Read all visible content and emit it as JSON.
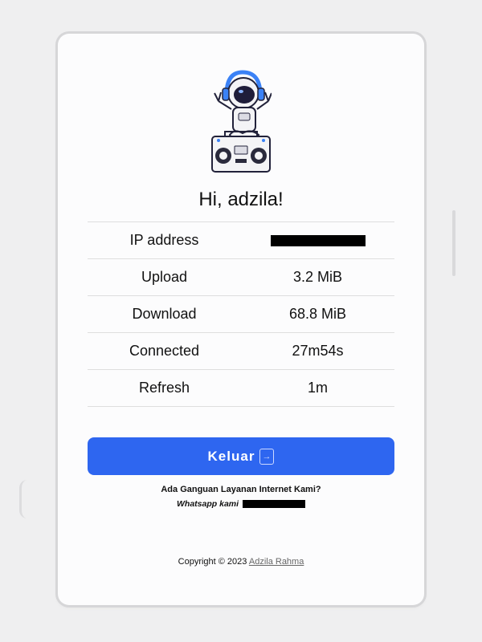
{
  "greeting": "Hi, adzila!",
  "info_rows": [
    {
      "label": "IP address",
      "value": "",
      "redacted": true
    },
    {
      "label": "Upload",
      "value": "3.2 MiB"
    },
    {
      "label": "Download",
      "value": "68.8 MiB"
    },
    {
      "label": "Connected",
      "value": "27m54s"
    },
    {
      "label": "Refresh",
      "value": "1m"
    }
  ],
  "logout_button": {
    "label": "Keluar",
    "icon": "logout-icon"
  },
  "support": {
    "question": "Ada Ganguan Layanan Internet Kami?",
    "whatsapp_prefix": "Whatsapp kami"
  },
  "footer": {
    "copyright": "Copyright © 2023",
    "author_link": "Adzila Rahma"
  },
  "mascot": {
    "icon": "astronaut-dj-icon"
  },
  "colors": {
    "accent": "#2e66f0",
    "background": "#efeff0",
    "card": "#fcfcfd"
  }
}
